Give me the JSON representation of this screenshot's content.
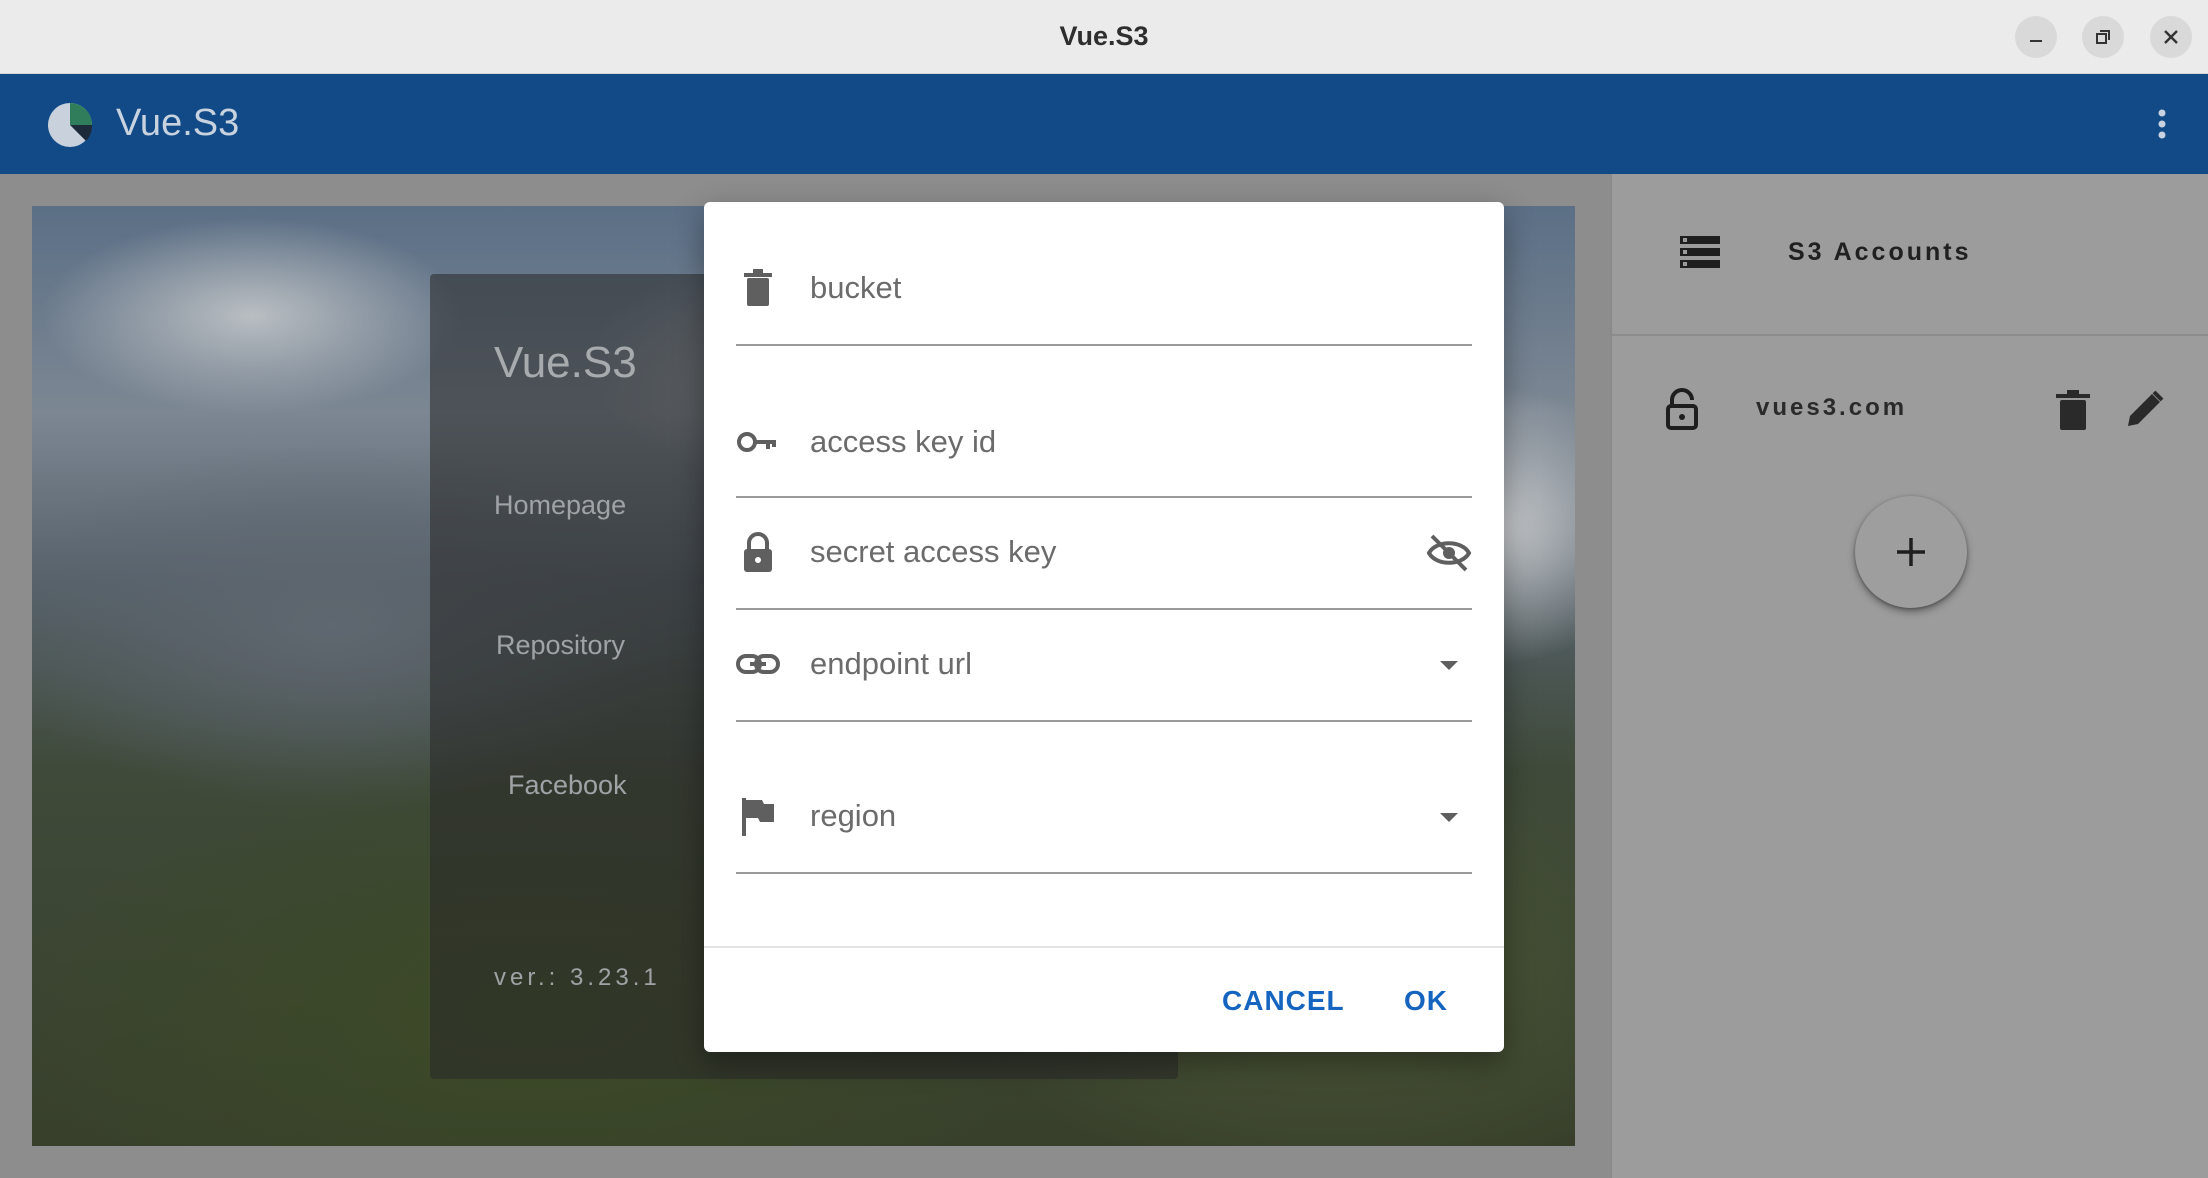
{
  "window": {
    "title": "Vue.S3",
    "controls": [
      "minimize-icon",
      "restore-icon",
      "close-icon"
    ]
  },
  "appbar": {
    "title": "Vue.S3",
    "logo": "pie-logo-icon",
    "menu_icon": "more-vertical-icon",
    "color": "#114a87"
  },
  "hero": {
    "title": "Vue.S3",
    "links": [
      "Homepage",
      "Repository",
      "Facebook"
    ],
    "version": "ver.: 3.23.1"
  },
  "side": {
    "header_icon": "storage-icon",
    "header_label": "S3 Accounts",
    "accounts": [
      {
        "name": "vues3.com",
        "lock_icon": "lock-open-icon",
        "delete_icon": "delete-icon",
        "edit_icon": "pencil-icon"
      }
    ],
    "add_icon": "plus-icon"
  },
  "dialog": {
    "fields": {
      "bucket": {
        "label": "bucket",
        "icon": "trash-bin-icon"
      },
      "access_key": {
        "label": "access key id",
        "icon": "key-icon"
      },
      "secret_key": {
        "label": "secret access key",
        "icon": "lock-icon",
        "trailing_icon": "eye-off-icon"
      },
      "endpoint": {
        "label": "endpoint url",
        "icon": "link-icon",
        "trailing_icon": "dropdown-arrow-icon"
      },
      "region": {
        "label": "region",
        "icon": "flag-icon",
        "trailing_icon": "dropdown-arrow-icon"
      }
    },
    "cancel_label": "CANCEL",
    "ok_label": "OK",
    "accent": "#1565c0"
  }
}
